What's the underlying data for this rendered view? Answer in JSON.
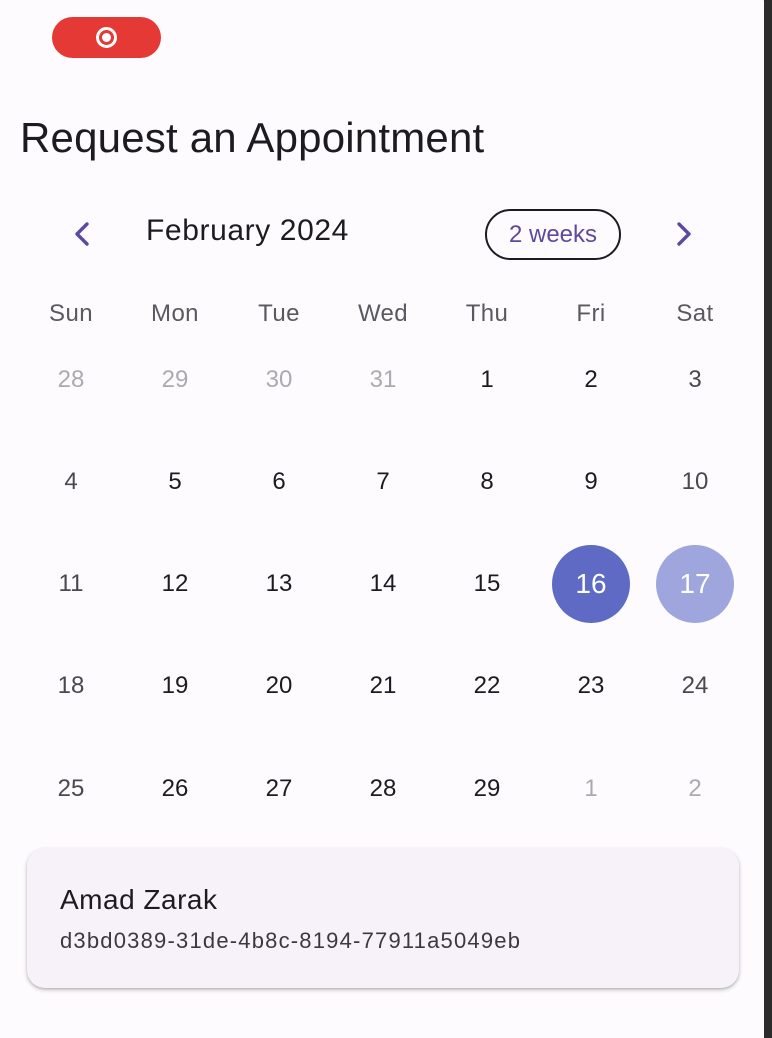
{
  "recording_indicator": {
    "icon": "record-icon",
    "color": "#e53935"
  },
  "page_title": "Request an Appointment",
  "calendar": {
    "month_label": "February 2024",
    "format_button_label": "2 weeks",
    "prev_icon": "chevron-left-icon",
    "next_icon": "chevron-right-icon",
    "accent_color": "#5e6ac4",
    "today_color": "#9ea6dd",
    "weekdays": [
      "Sun",
      "Mon",
      "Tue",
      "Wed",
      "Thu",
      "Fri",
      "Sat"
    ],
    "weeks": [
      [
        "28",
        "29",
        "30",
        "31",
        "1",
        "2",
        "3"
      ],
      [
        "4",
        "5",
        "6",
        "7",
        "8",
        "9",
        "10"
      ],
      [
        "11",
        "12",
        "13",
        "14",
        "15",
        "16",
        "17"
      ],
      [
        "18",
        "19",
        "20",
        "21",
        "22",
        "23",
        "24"
      ],
      [
        "25",
        "26",
        "27",
        "28",
        "29",
        "1",
        "2"
      ]
    ],
    "selected_day": "16",
    "today": "17"
  },
  "provider_card": {
    "name": "Amad Zarak",
    "id": "d3bd0389-31de-4b8c-8194-77911a5049eb"
  }
}
